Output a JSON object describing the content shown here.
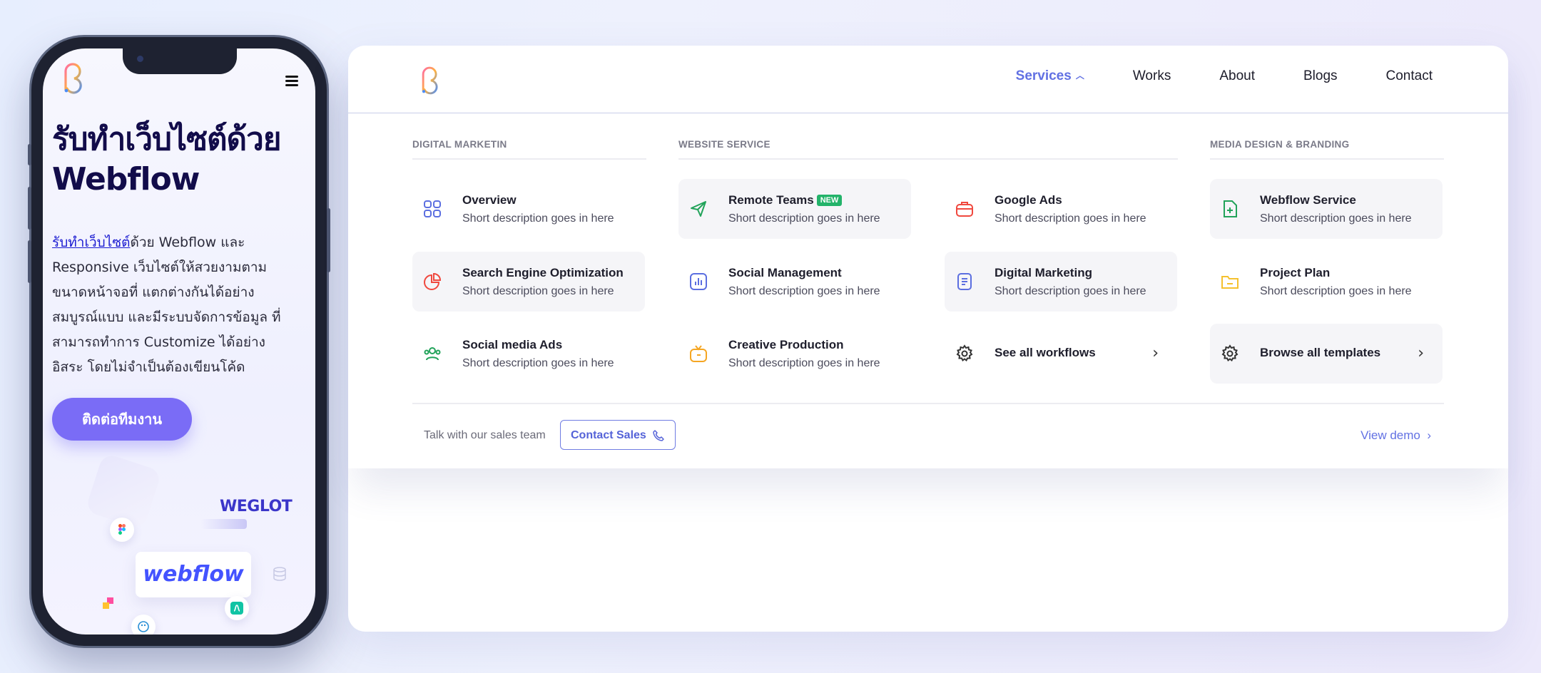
{
  "mobile": {
    "hero_title": "รับทำเว็บไซต์ด้วย Webflow",
    "desc_link": "รับทำเว็บไซต์",
    "desc_text": "ด้วย Webflow และ Responsive เว็บไซต์ให้สวยงามตามขนาดหน้าจอที่ แตกต่างกันได้อย่างสมบูรณ์แบบ  และมีระบบจัดการข้อมูล ที่สามารถทำการ Customize ได้อย่างอิสระ โดยไม่จำเป็นต้องเขียนโค้ด",
    "cta_label": "ติดต่อทีมงาน",
    "weglot_logo": "WEGLOT",
    "webflow_logo": "webflow"
  },
  "nav": {
    "links": [
      "Services",
      "Works",
      "About",
      "Blogs",
      "Contact"
    ],
    "active": "Services"
  },
  "menu": {
    "columns": [
      "DIGITAL MARKETIN",
      "WEBSITE SERVICE",
      "MEDIA DESIGN & BRANDING"
    ],
    "items": [
      {
        "title": "Overview",
        "desc": "Short description goes in here",
        "icon": "grid-icon",
        "color": "#5b6ee0"
      },
      {
        "title": "Search Engine Optimization",
        "desc": "Short description goes in here",
        "icon": "pie-chart-icon",
        "color": "#f0483e"
      },
      {
        "title": "Social media Ads",
        "desc": "Short description goes in here",
        "icon": "users-icon",
        "color": "#22a35a"
      },
      {
        "title": "Remote Teams",
        "badge": "NEW",
        "desc": "Short description goes in here",
        "icon": "send-icon",
        "color": "#22a35a"
      },
      {
        "title": "Social Management",
        "desc": "Short description goes in here",
        "icon": "bar-chart-icon",
        "color": "#5b6ee0"
      },
      {
        "title": "Creative Production",
        "desc": "Short description goes in here",
        "icon": "tv-icon",
        "color": "#f5a623"
      },
      {
        "title": "Google Ads",
        "desc": "Short description goes in here",
        "icon": "briefcase-icon",
        "color": "#f0483e"
      },
      {
        "title": "Digital Marketing",
        "desc": "Short description goes in here",
        "icon": "document-icon",
        "color": "#5b6ee0"
      },
      {
        "title": "See all workflows",
        "icon": "gear-icon",
        "color": "#333333"
      },
      {
        "title": "Webflow Service",
        "desc": "Short description goes in here",
        "icon": "file-plus-icon",
        "color": "#22a35a"
      },
      {
        "title": "Project Plan",
        "desc": "Short description goes in here",
        "icon": "folder-icon",
        "color": "#f5c12e"
      },
      {
        "title": "Browse all templates",
        "icon": "gear-icon",
        "color": "#333333"
      }
    ],
    "footer": {
      "sales_text": "Talk with our sales team",
      "contact_label": "Contact Sales",
      "view_demo": "View demo"
    }
  },
  "colors": {
    "accent": "#6271e3",
    "cta": "#7a6cf6",
    "badge_green": "#23b36a"
  }
}
